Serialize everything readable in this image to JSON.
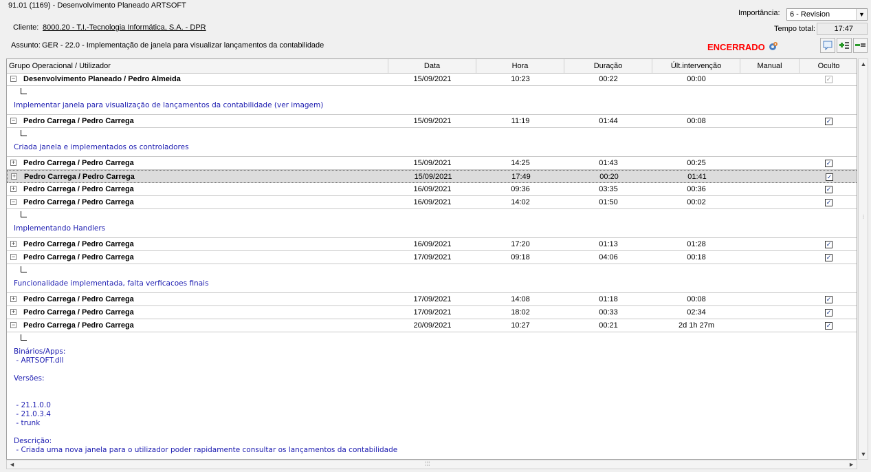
{
  "window": {
    "title": "91.01 (1169) - Desenvolvimento Planeado ARTSOFT"
  },
  "header": {
    "client_label": "Cliente:",
    "client_value": "8000.20 - T.I.-Tecnologia  Informática, S.A. - DPR",
    "subject_label": "Assunto:",
    "subject_value": "GER - 22.0 - Implementação de janela para visualizar lançamentos da contabilidade",
    "importance_label": "Importância:",
    "importance_value": "6 - Revision",
    "total_time_label": "Tempo total:",
    "total_time_value": "17:47",
    "status": "ENCERRADO",
    "status_color": "#ff0000"
  },
  "toolbar": {
    "icons": [
      "speech-bubble-icon",
      "add-green-icon",
      "remove-green-icon",
      "gear-icon"
    ]
  },
  "grid": {
    "columns": [
      "Grupo Operacional / Utilizador",
      "Data",
      "Hora",
      "Duração",
      "Últ.intervenção",
      "Manual",
      "Oculto"
    ],
    "rows": [
      {
        "expander": "−",
        "group": "Desenvolvimento Planeado / Pedro Almeida",
        "date": "15/09/2021",
        "time": "10:23",
        "duration": "00:22",
        "last": "00:00",
        "oculto": "✓",
        "memo": "Implementar janela para visualização de lançamentos da contabilidade (ver imagem)"
      },
      {
        "expander": "−",
        "group": "Pedro Carrega / Pedro Carrega",
        "date": "15/09/2021",
        "time": "11:19",
        "duration": "01:44",
        "last": "00:08",
        "oculto": "✓",
        "memo": "Criada janela e implementados os controladores"
      },
      {
        "expander": "+",
        "group": "Pedro Carrega / Pedro Carrega",
        "date": "15/09/2021",
        "time": "14:25",
        "duration": "01:43",
        "last": "00:25",
        "oculto": "✓"
      },
      {
        "expander": "+",
        "group": "Pedro Carrega / Pedro Carrega",
        "date": "15/09/2021",
        "time": "17:49",
        "duration": "00:20",
        "last": "01:41",
        "oculto": "✓"
      },
      {
        "expander": "+",
        "group": "Pedro Carrega / Pedro Carrega",
        "date": "16/09/2021",
        "time": "09:36",
        "duration": "03:35",
        "last": "00:36",
        "oculto": "✓"
      },
      {
        "expander": "−",
        "group": "Pedro Carrega / Pedro Carrega",
        "date": "16/09/2021",
        "time": "14:02",
        "duration": "01:50",
        "last": "00:02",
        "oculto": "✓",
        "memo": "Implementando Handlers"
      },
      {
        "expander": "+",
        "group": "Pedro Carrega / Pedro Carrega",
        "date": "16/09/2021",
        "time": "17:20",
        "duration": "01:13",
        "last": "01:28",
        "oculto": "✓"
      },
      {
        "expander": "−",
        "group": "Pedro Carrega / Pedro Carrega",
        "date": "17/09/2021",
        "time": "09:18",
        "duration": "04:06",
        "last": "00:18",
        "oculto": "✓",
        "memo": "Funcionalidade implementada, falta verficacoes finais"
      },
      {
        "expander": "+",
        "group": "Pedro Carrega / Pedro Carrega",
        "date": "17/09/2021",
        "time": "14:08",
        "duration": "01:18",
        "last": "00:08",
        "oculto": "✓"
      },
      {
        "expander": "+",
        "group": "Pedro Carrega / Pedro Carrega",
        "date": "17/09/2021",
        "time": "18:02",
        "duration": "00:33",
        "last": "02:34",
        "oculto": "✓"
      },
      {
        "expander": "−",
        "group": "Pedro Carrega / Pedro Carrega",
        "date": "20/09/2021",
        "time": "10:27",
        "duration": "00:21",
        "last": "2d 1h 27m",
        "oculto": "✓",
        "memo": "Binários/Apps:\n - ARTSOFT.dll\n\nVersões:\n\n\n - 21.1.0.0\n - 21.0.3.4\n - trunk\n\nDescrição:\n - Criada uma nova janela para o utilizador poder rapidamente consultar os lançamentos da contabilidade"
      }
    ]
  }
}
